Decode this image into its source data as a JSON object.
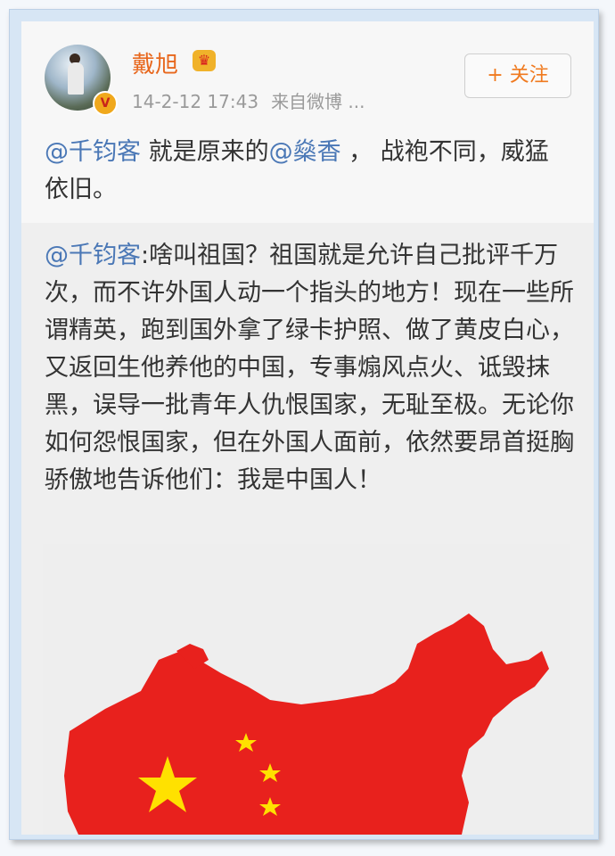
{
  "post": {
    "username": "戴旭",
    "timestamp": "14-2-12 17:43",
    "source": "来自微博 ...",
    "follow_label": "+ 关注",
    "verified_badge": "V",
    "crown_icon": "crown-icon",
    "text": {
      "mention1": "@千钧客",
      "part1": " 就是原来的",
      "mention2": "@燊香",
      "part2": " ， 战袍不同，威猛依旧。"
    }
  },
  "repost": {
    "mention": "@千钧客",
    "text": ":啥叫祖国？祖国就是允许自己批评千万次，而不许外国人动一个指头的地方！现在一些所谓精英，跑到国外拿了绿卡护照、做了黄皮白心，又返回生他养他的中国，专事煽风点火、诋毁抹黑，误导一批青年人仇恨国家，无耻至极。无论你如何怨恨国家，但在外国人面前，依然要昂首挺胸骄傲地告诉他们：我是中国人！"
  },
  "image": {
    "subject": "china-map-with-stars",
    "colors": {
      "map": "#e8211d",
      "star": "#ffe100",
      "background": "#eeeeee"
    }
  },
  "colors": {
    "mention": "#4b78b6",
    "username": "#e8681e",
    "follow": "#f07a1f"
  }
}
